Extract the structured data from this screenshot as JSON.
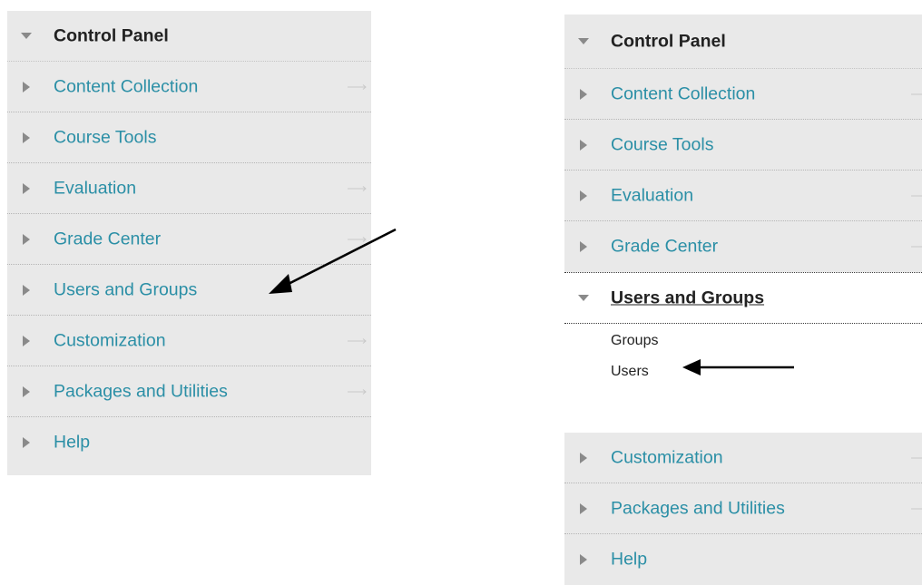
{
  "left_panel": {
    "header": "Control Panel",
    "items": [
      {
        "label": "Content Collection"
      },
      {
        "label": "Course Tools"
      },
      {
        "label": "Evaluation"
      },
      {
        "label": "Grade Center"
      },
      {
        "label": "Users and Groups"
      },
      {
        "label": "Customization"
      },
      {
        "label": "Packages and Utilities"
      },
      {
        "label": "Help"
      }
    ]
  },
  "right_panel": {
    "header": "Control Panel",
    "items_before": [
      {
        "label": "Content Collection"
      },
      {
        "label": "Course Tools"
      },
      {
        "label": "Evaluation"
      },
      {
        "label": "Grade Center"
      }
    ],
    "expanded": {
      "label": "Users and Groups",
      "sub_items": [
        "Groups",
        "Users"
      ]
    },
    "items_after": [
      {
        "label": "Customization"
      },
      {
        "label": "Packages and Utilities"
      },
      {
        "label": "Help"
      }
    ]
  },
  "colors": {
    "panel_bg": "#e9e9e9",
    "link": "#2b8fa6",
    "header_text": "#222222",
    "triangle": "#8a8a8a"
  },
  "icons": [
    "triangle-down-icon",
    "triangle-right-icon",
    "row-arrow-icon",
    "annotation-arrow"
  ]
}
